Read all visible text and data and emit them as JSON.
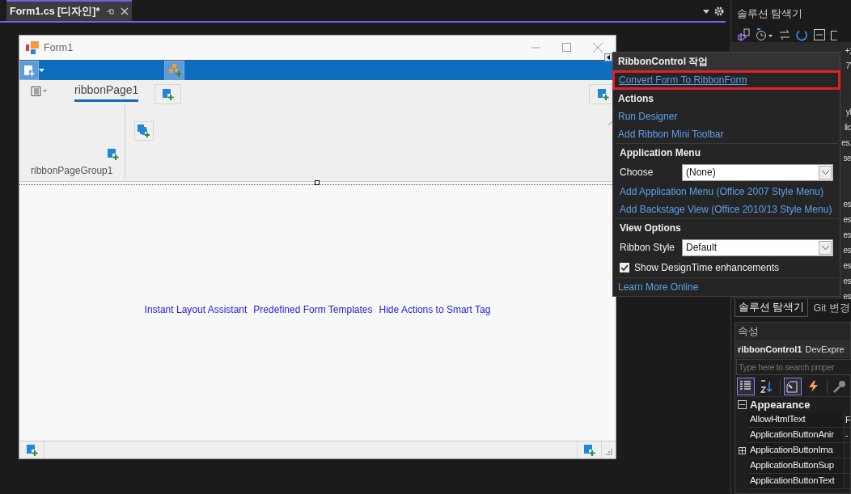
{
  "document_tab": {
    "title": "Form1.cs [디자인]*",
    "selected": true
  },
  "form": {
    "title": "Form1",
    "ribbon_page": {
      "label": "ribbonPage1",
      "selected": true
    },
    "ribbon_group": "ribbonPageGroup1",
    "designer_links": [
      "Instant Layout Assistant",
      "Predefined Form Templates",
      "Hide Actions to Smart Tag"
    ]
  },
  "smart_tag": {
    "title": "RibbonControl 작업",
    "highlighted_link": "Convert Form To RibbonForm",
    "sections": [
      {
        "heading": "Actions",
        "items": [
          {
            "kind": "link",
            "label": "Run Designer"
          },
          {
            "kind": "link",
            "label": "Add Ribbon Mini Toolbar"
          }
        ]
      },
      {
        "heading": "Application Menu",
        "items": [
          {
            "kind": "combo",
            "label": "Choose",
            "value": "(None)"
          },
          {
            "kind": "link",
            "label": "Add Application Menu (Office 2007 Style Menu)"
          },
          {
            "kind": "link",
            "label": "Add Backstage View (Office 2010/13 Style Menu)"
          }
        ]
      },
      {
        "heading": "View Options",
        "items": [
          {
            "kind": "combo",
            "label": "Ribbon Style",
            "value": "Default"
          },
          {
            "kind": "checkbox",
            "label": "Show DesignTime enhancements",
            "checked": true
          }
        ]
      }
    ],
    "footer_link": "Learn More Online"
  },
  "solution_explorer": {
    "title": "솔루션 탐색기",
    "fragment_groups": [
      [
        "+;",
        "7'"
      ],
      [
        "yl",
        "lic",
        "es.",
        "se"
      ],
      [
        "es",
        "es",
        "es",
        "es",
        "es",
        "es",
        "es"
      ]
    ]
  },
  "bottom_tabs": [
    {
      "label": "솔루션 탐색기",
      "selected": true
    },
    {
      "label": "Git 변경",
      "selected": false
    }
  ],
  "properties": {
    "title": "속성",
    "object_name": "ribbonControl1",
    "object_type": "DevExpre",
    "search_placeholder": "Type here to search proper",
    "toolbar": [
      {
        "selected": true
      },
      {
        "selected": false
      },
      {
        "selected": true
      },
      {
        "selected": false
      },
      {
        "selected": false
      }
    ],
    "category": {
      "label": "Appearance",
      "expanded": true
    },
    "rows": [
      {
        "name": "AllowHtmlText",
        "value": "F",
        "expandable": false
      },
      {
        "name": "ApplicationButtonAnir",
        "value": "-",
        "expandable": false
      },
      {
        "name": "ApplicationButtonIma",
        "expandable": true
      },
      {
        "name": "ApplicationButtonSup",
        "expandable": false
      },
      {
        "name": "ApplicationButtonText",
        "expandable": false
      }
    ]
  }
}
